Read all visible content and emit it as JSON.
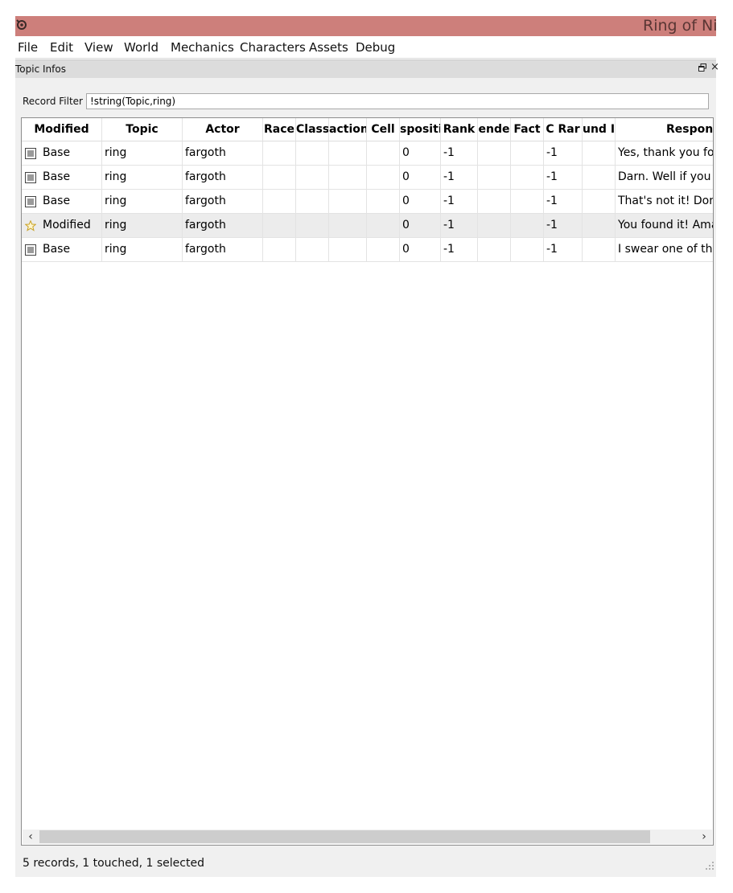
{
  "window": {
    "title": "Ring of Nig",
    "app_icon": "app-logo-icon"
  },
  "menu": [
    "File",
    "Edit",
    "View",
    "World",
    "Mechanics",
    "Characters",
    "Assets",
    "Debug"
  ],
  "dock": {
    "title": "Topic Infos",
    "float_icon": "float-window-icon",
    "close_icon": "close-icon",
    "close_glyph": "×"
  },
  "filter": {
    "label": "Record Filter",
    "value": "!string(Topic,ring)"
  },
  "table": {
    "columns": [
      "Modified",
      "Topic",
      "Actor",
      "Race",
      "Class",
      "action",
      "Cell",
      "spositi",
      "Rank",
      "ende",
      "Fact",
      "C Rar",
      "und I",
      "Respons"
    ],
    "rows": [
      {
        "modified": "Base",
        "state_icon": "checkbox-icon",
        "topic": "ring",
        "actor": "fargoth",
        "race": "",
        "class": "",
        "faction": "",
        "cell": "",
        "disposition": "0",
        "rank": "-1",
        "gender": "",
        "fact": "",
        "pc_rank": "-1",
        "sound": "",
        "response": "Yes, thank you for"
      },
      {
        "modified": "Base",
        "state_icon": "checkbox-icon",
        "topic": "ring",
        "actor": "fargoth",
        "race": "",
        "class": "",
        "faction": "",
        "cell": "",
        "disposition": "0",
        "rank": "-1",
        "gender": "",
        "fact": "",
        "pc_rank": "-1",
        "sound": "",
        "response": "Darn. Well if you s"
      },
      {
        "modified": "Base",
        "state_icon": "checkbox-icon",
        "topic": "ring",
        "actor": "fargoth",
        "race": "",
        "class": "",
        "faction": "",
        "cell": "",
        "disposition": "0",
        "rank": "-1",
        "gender": "",
        "fact": "",
        "pc_rank": "-1",
        "sound": "",
        "response": "That's not it! Don't"
      },
      {
        "modified": "Modified",
        "state_icon": "star-icon",
        "topic": "ring",
        "actor": "fargoth",
        "race": "",
        "class": "",
        "faction": "",
        "cell": "",
        "disposition": "0",
        "rank": "-1",
        "gender": "",
        "fact": "",
        "pc_rank": "-1",
        "sound": "",
        "response": "You found it! Ama"
      },
      {
        "modified": "Base",
        "state_icon": "checkbox-icon",
        "topic": "ring",
        "actor": "fargoth",
        "race": "",
        "class": "",
        "faction": "",
        "cell": "",
        "disposition": "0",
        "rank": "-1",
        "gender": "",
        "fact": "",
        "pc_rank": "-1",
        "sound": "",
        "response": "I swear one of the"
      }
    ],
    "selected_row": 3
  },
  "scrollbar": {
    "left_arrow": "‹",
    "right_arrow": "›"
  },
  "status": "5 records, 1 touched, 1 selected",
  "colors": {
    "titlebar": "#cd7f7b",
    "star": "#c9a227"
  }
}
